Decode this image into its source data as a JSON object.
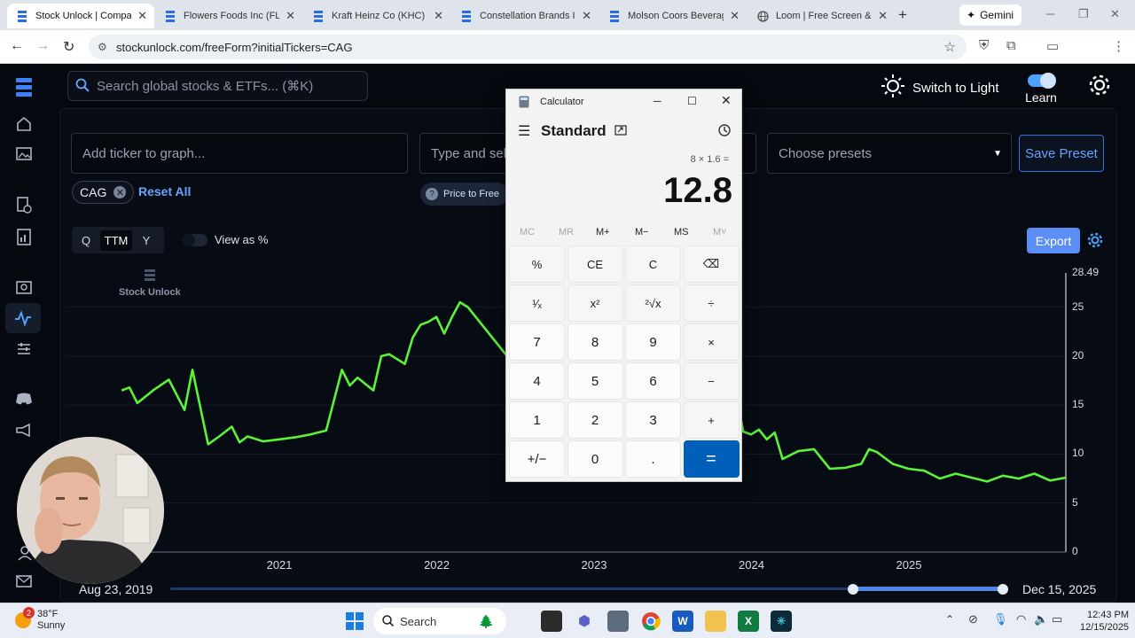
{
  "browser": {
    "tabs": [
      {
        "title": "Stock Unlock | Compare",
        "active": true
      },
      {
        "title": "Flowers Foods Inc (FLO)",
        "active": false
      },
      {
        "title": "Kraft Heinz Co (KHC) - S",
        "active": false
      },
      {
        "title": "Constellation Brands Inc",
        "active": false
      },
      {
        "title": "Molson Coors Beverage",
        "active": false
      },
      {
        "title": "Loom | Free Screen & Vi",
        "active": false
      }
    ],
    "new_tab": "+",
    "gemini": "Gemini",
    "url": "stockunlock.com/freeForm?initialTickers=CAG"
  },
  "app": {
    "search_placeholder": "Search global stocks & ETFs... (⌘K)",
    "switch_label": "Switch to Light",
    "learn_label": "Learn",
    "ticker_placeholder": "Add ticker to graph...",
    "metric_placeholder": "Type and sele",
    "preset_placeholder": "Choose presets",
    "save_preset": "Save Preset",
    "chip": "CAG",
    "reset_all": "Reset All",
    "price_badge": "Price to Free",
    "period": [
      "Q",
      "TTM",
      "Y"
    ],
    "view_pct": "View as %",
    "export": "Export",
    "watermark": "Stock Unlock",
    "date_start": "Aug 23, 2019",
    "date_end": "Dec 15, 2025"
  },
  "chart_data": {
    "type": "line",
    "y_ticks": [
      "28.49",
      "25",
      "20",
      "15",
      "10",
      "5",
      "0"
    ],
    "x_ticks": [
      "2021",
      "2022",
      "2023",
      "2024",
      "2025"
    ],
    "ylim": [
      0,
      28.49
    ],
    "line_color": "#5df23a",
    "series": [
      {
        "x": [
          2020.0,
          2020.05,
          2020.1,
          2020.2,
          2020.3,
          2020.4,
          2020.45,
          2020.55,
          2020.62,
          2020.7,
          2020.75,
          2020.8,
          2020.9,
          2021.0,
          2021.1,
          2021.2,
          2021.3,
          2021.4,
          2021.45,
          2021.5,
          2021.6,
          2021.65,
          2021.7,
          2021.8,
          2021.85,
          2021.9,
          2021.95,
          2022.0,
          2022.05,
          2022.1,
          2022.15,
          2022.2,
          2022.25,
          2022.3,
          2022.35,
          2022.4,
          2022.45
        ],
        "values": [
          16.5,
          16.8,
          15.2,
          16.5,
          17.6,
          14.5,
          18.6,
          11.0,
          11.8,
          12.8,
          11.2,
          11.8,
          11.3,
          11.5,
          11.7,
          12.0,
          12.4,
          18.6,
          17.0,
          17.8,
          16.5,
          20.0,
          20.2,
          19.2,
          21.9,
          23.2,
          23.5,
          24.0,
          22.3,
          24.0,
          25.5,
          25.0,
          24.0,
          23.0,
          22.0,
          21.0,
          20.0
        ]
      },
      {
        "x": [
          2023.9,
          2023.95,
          2024.0,
          2024.05,
          2024.1,
          2024.15,
          2024.2,
          2024.3,
          2024.4,
          2024.5,
          2024.6,
          2024.7,
          2024.75,
          2024.8,
          2024.9,
          2025.0,
          2025.1,
          2025.2,
          2025.3,
          2025.4,
          2025.5,
          2025.6,
          2025.7,
          2025.8,
          2025.9,
          2026.0
        ],
        "values": [
          16.5,
          12.3,
          12.0,
          12.5,
          11.5,
          12.2,
          9.5,
          10.3,
          10.5,
          8.5,
          8.6,
          9.0,
          10.5,
          10.2,
          9.0,
          8.5,
          8.3,
          7.5,
          8.0,
          7.6,
          7.2,
          7.8,
          7.5,
          8.0,
          7.3,
          7.6
        ]
      }
    ]
  },
  "calculator": {
    "title": "Calculator",
    "mode": "Standard",
    "expression": "8 × 1.6 =",
    "result": "12.8",
    "memory": [
      "MC",
      "MR",
      "M+",
      "M−",
      "MS",
      "M˅"
    ],
    "keys": [
      [
        "%",
        "CE",
        "C",
        "⌫"
      ],
      [
        "¹⁄ₓ",
        "x²",
        "²√x",
        "÷"
      ],
      [
        "7",
        "8",
        "9",
        "×"
      ],
      [
        "4",
        "5",
        "6",
        "−"
      ],
      [
        "1",
        "2",
        "3",
        "+"
      ],
      [
        "+/−",
        "0",
        ".",
        "="
      ]
    ]
  },
  "taskbar": {
    "temp": "38°F",
    "condition": "Sunny",
    "badge": "2",
    "search": "Search",
    "time": "12:43 PM",
    "date": "12/15/2025"
  }
}
